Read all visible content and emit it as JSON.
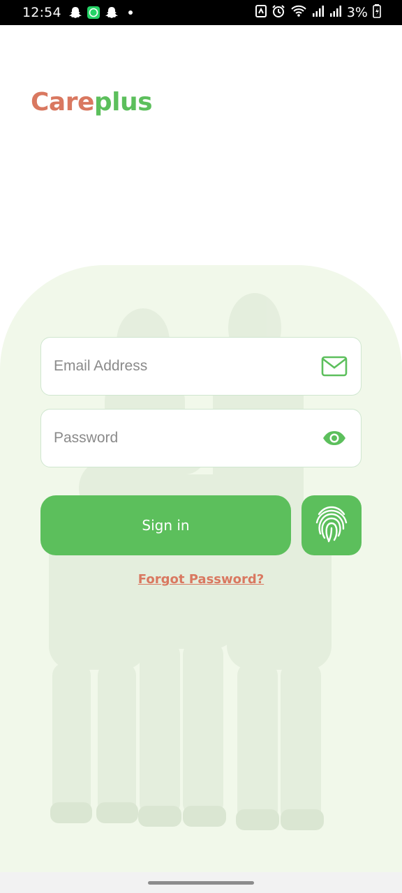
{
  "status_bar": {
    "time": "12:54",
    "battery": "3%",
    "notification_icons": [
      "snapchat-icon",
      "whatsapp-icon",
      "snapchat-icon"
    ],
    "system_icons": [
      "nfc-icon",
      "alarm-icon",
      "wifi-icon",
      "signal-icon",
      "signal-icon",
      "battery-icon"
    ]
  },
  "app": {
    "logo_care": "Care",
    "logo_plus": "plus"
  },
  "login": {
    "email_placeholder": "Email Address",
    "password_placeholder": "Password",
    "signin_label": "Sign in",
    "forgot_label": "Forgot Password?"
  },
  "colors": {
    "brand_green": "#5cbf5c",
    "brand_orange": "#d97860",
    "card_background": "#f1f8ea"
  }
}
